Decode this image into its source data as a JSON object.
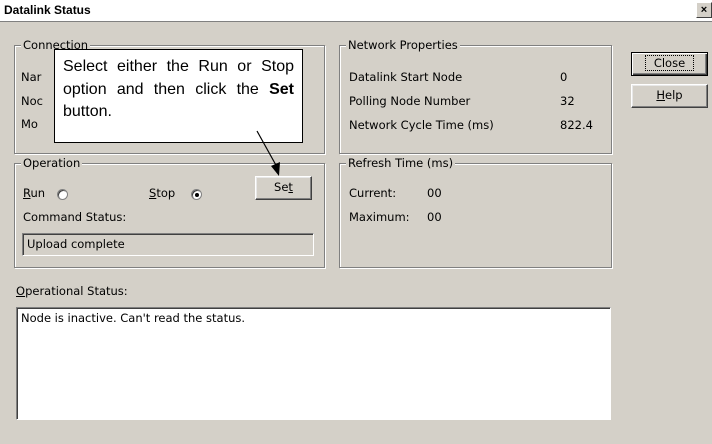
{
  "window": {
    "title": "Datalink Status",
    "close_glyph": "×"
  },
  "connection": {
    "legend": "Connection",
    "rows": [
      "Nar",
      "Noc",
      "Mo"
    ]
  },
  "network": {
    "legend": "Network Properties",
    "rows": [
      {
        "label": "Datalink Start Node",
        "value": "0"
      },
      {
        "label": "Polling Node Number",
        "value": "32"
      },
      {
        "label": "Network Cycle Time (ms)",
        "value": "822.4"
      }
    ]
  },
  "operation": {
    "legend": "Operation",
    "run_label": "Run",
    "run_mnemonic": "R",
    "stop_label": "Stop",
    "stop_mnemonic": "S",
    "selected": "stop",
    "set_label": "Set",
    "command_status_label": "Command Status:",
    "command_status_value": "Upload complete"
  },
  "refresh": {
    "legend": "Refresh Time (ms)",
    "current_label": "Current:",
    "current_value": "00",
    "maximum_label": "Maximum:",
    "maximum_value": "00"
  },
  "buttons": {
    "close": "Close",
    "help": "Help"
  },
  "operational_status": {
    "label": "Operational Status:",
    "text": "Node is inactive. Can't read the status."
  },
  "callout": {
    "text_before": "Select either the Run or Stop option and then click the ",
    "bold": "Set",
    "text_after": " button."
  }
}
